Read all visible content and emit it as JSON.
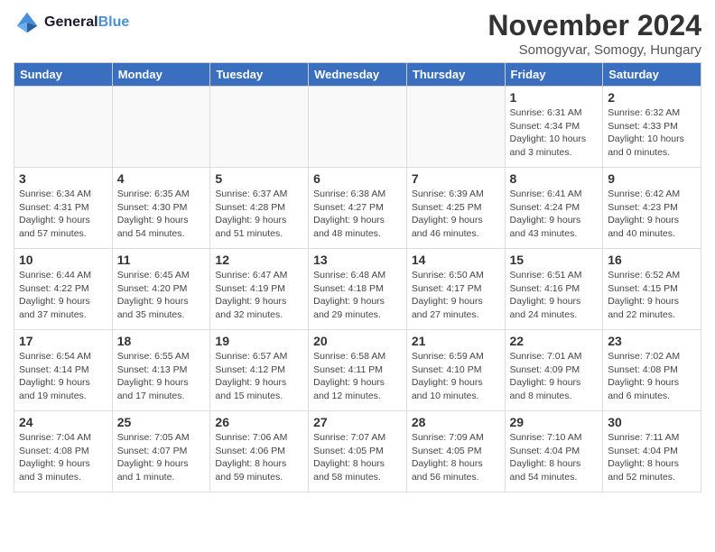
{
  "header": {
    "logo_line1": "General",
    "logo_line2": "Blue",
    "title": "November 2024",
    "subtitle": "Somogyvar, Somogy, Hungary"
  },
  "weekdays": [
    "Sunday",
    "Monday",
    "Tuesday",
    "Wednesday",
    "Thursday",
    "Friday",
    "Saturday"
  ],
  "weeks": [
    [
      {
        "day": "",
        "info": ""
      },
      {
        "day": "",
        "info": ""
      },
      {
        "day": "",
        "info": ""
      },
      {
        "day": "",
        "info": ""
      },
      {
        "day": "",
        "info": ""
      },
      {
        "day": "1",
        "info": "Sunrise: 6:31 AM\nSunset: 4:34 PM\nDaylight: 10 hours\nand 3 minutes."
      },
      {
        "day": "2",
        "info": "Sunrise: 6:32 AM\nSunset: 4:33 PM\nDaylight: 10 hours\nand 0 minutes."
      }
    ],
    [
      {
        "day": "3",
        "info": "Sunrise: 6:34 AM\nSunset: 4:31 PM\nDaylight: 9 hours\nand 57 minutes."
      },
      {
        "day": "4",
        "info": "Sunrise: 6:35 AM\nSunset: 4:30 PM\nDaylight: 9 hours\nand 54 minutes."
      },
      {
        "day": "5",
        "info": "Sunrise: 6:37 AM\nSunset: 4:28 PM\nDaylight: 9 hours\nand 51 minutes."
      },
      {
        "day": "6",
        "info": "Sunrise: 6:38 AM\nSunset: 4:27 PM\nDaylight: 9 hours\nand 48 minutes."
      },
      {
        "day": "7",
        "info": "Sunrise: 6:39 AM\nSunset: 4:25 PM\nDaylight: 9 hours\nand 46 minutes."
      },
      {
        "day": "8",
        "info": "Sunrise: 6:41 AM\nSunset: 4:24 PM\nDaylight: 9 hours\nand 43 minutes."
      },
      {
        "day": "9",
        "info": "Sunrise: 6:42 AM\nSunset: 4:23 PM\nDaylight: 9 hours\nand 40 minutes."
      }
    ],
    [
      {
        "day": "10",
        "info": "Sunrise: 6:44 AM\nSunset: 4:22 PM\nDaylight: 9 hours\nand 37 minutes."
      },
      {
        "day": "11",
        "info": "Sunrise: 6:45 AM\nSunset: 4:20 PM\nDaylight: 9 hours\nand 35 minutes."
      },
      {
        "day": "12",
        "info": "Sunrise: 6:47 AM\nSunset: 4:19 PM\nDaylight: 9 hours\nand 32 minutes."
      },
      {
        "day": "13",
        "info": "Sunrise: 6:48 AM\nSunset: 4:18 PM\nDaylight: 9 hours\nand 29 minutes."
      },
      {
        "day": "14",
        "info": "Sunrise: 6:50 AM\nSunset: 4:17 PM\nDaylight: 9 hours\nand 27 minutes."
      },
      {
        "day": "15",
        "info": "Sunrise: 6:51 AM\nSunset: 4:16 PM\nDaylight: 9 hours\nand 24 minutes."
      },
      {
        "day": "16",
        "info": "Sunrise: 6:52 AM\nSunset: 4:15 PM\nDaylight: 9 hours\nand 22 minutes."
      }
    ],
    [
      {
        "day": "17",
        "info": "Sunrise: 6:54 AM\nSunset: 4:14 PM\nDaylight: 9 hours\nand 19 minutes."
      },
      {
        "day": "18",
        "info": "Sunrise: 6:55 AM\nSunset: 4:13 PM\nDaylight: 9 hours\nand 17 minutes."
      },
      {
        "day": "19",
        "info": "Sunrise: 6:57 AM\nSunset: 4:12 PM\nDaylight: 9 hours\nand 15 minutes."
      },
      {
        "day": "20",
        "info": "Sunrise: 6:58 AM\nSunset: 4:11 PM\nDaylight: 9 hours\nand 12 minutes."
      },
      {
        "day": "21",
        "info": "Sunrise: 6:59 AM\nSunset: 4:10 PM\nDaylight: 9 hours\nand 10 minutes."
      },
      {
        "day": "22",
        "info": "Sunrise: 7:01 AM\nSunset: 4:09 PM\nDaylight: 9 hours\nand 8 minutes."
      },
      {
        "day": "23",
        "info": "Sunrise: 7:02 AM\nSunset: 4:08 PM\nDaylight: 9 hours\nand 6 minutes."
      }
    ],
    [
      {
        "day": "24",
        "info": "Sunrise: 7:04 AM\nSunset: 4:08 PM\nDaylight: 9 hours\nand 3 minutes."
      },
      {
        "day": "25",
        "info": "Sunrise: 7:05 AM\nSunset: 4:07 PM\nDaylight: 9 hours\nand 1 minute."
      },
      {
        "day": "26",
        "info": "Sunrise: 7:06 AM\nSunset: 4:06 PM\nDaylight: 8 hours\nand 59 minutes."
      },
      {
        "day": "27",
        "info": "Sunrise: 7:07 AM\nSunset: 4:05 PM\nDaylight: 8 hours\nand 58 minutes."
      },
      {
        "day": "28",
        "info": "Sunrise: 7:09 AM\nSunset: 4:05 PM\nDaylight: 8 hours\nand 56 minutes."
      },
      {
        "day": "29",
        "info": "Sunrise: 7:10 AM\nSunset: 4:04 PM\nDaylight: 8 hours\nand 54 minutes."
      },
      {
        "day": "30",
        "info": "Sunrise: 7:11 AM\nSunset: 4:04 PM\nDaylight: 8 hours\nand 52 minutes."
      }
    ]
  ]
}
